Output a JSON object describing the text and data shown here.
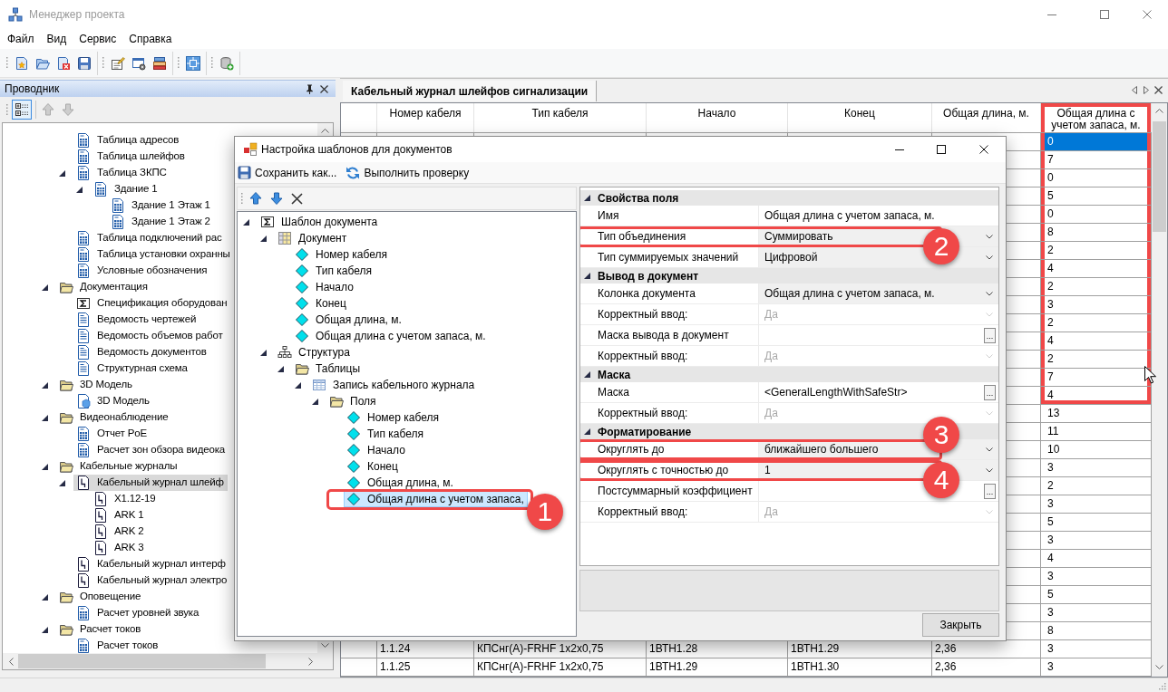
{
  "window": {
    "title": "Менеджер проекта"
  },
  "menu": [
    {
      "label": "Файл"
    },
    {
      "label": "Вид"
    },
    {
      "label": "Сервис"
    },
    {
      "label": "Справка"
    }
  ],
  "explorer": {
    "title": "Проводник",
    "tree": [
      {
        "children": [
          {
            "label": "Таблица адресов",
            "kind": "table",
            "selected": false
          },
          {
            "label": "Таблица шлейфов",
            "kind": "table",
            "selected": false
          },
          {
            "label": "Таблица ЗКПС",
            "kind": "table",
            "selected": false,
            "expanded": true,
            "children": [
              {
                "label": "Здание 1",
                "kind": "table",
                "selected": false,
                "expanded": true,
                "children": [
                  {
                    "label": "Здание 1 Этаж 1",
                    "kind": "table",
                    "selected": false
                  },
                  {
                    "label": "Здание 1 Этаж 2",
                    "kind": "table",
                    "selected": false
                  }
                ]
              }
            ]
          },
          {
            "label": "Таблица подключений рас",
            "kind": "table",
            "selected": false
          },
          {
            "label": "Таблица установки охранны",
            "kind": "table",
            "selected": false
          },
          {
            "label": "Условные обозначения",
            "kind": "table",
            "selected": false
          }
        ]
      },
      {
        "label": "Документация",
        "kind": "folder",
        "selected": false,
        "expanded": true,
        "children": [
          {
            "label": "Спецификация оборудован",
            "kind": "sigma",
            "selected": false
          },
          {
            "label": "Ведомость чертежей",
            "kind": "document",
            "selected": false
          },
          {
            "label": "Ведомость объемов работ",
            "kind": "document",
            "selected": false
          },
          {
            "label": "Ведомость документов",
            "kind": "document",
            "selected": false
          },
          {
            "label": "Структурная схема",
            "kind": "document",
            "selected": false
          }
        ]
      },
      {
        "label": "3D Модель",
        "kind": "folder",
        "selected": false,
        "expanded": true,
        "children": [
          {
            "label": "3D Модель",
            "kind": "model",
            "selected": false
          }
        ]
      },
      {
        "label": "Видеонаблюдение",
        "kind": "folder",
        "selected": false,
        "expanded": true,
        "children": [
          {
            "label": "Отчет PoE",
            "kind": "table",
            "selected": false
          },
          {
            "label": "Расчет зон обзора видеока",
            "kind": "table",
            "selected": false
          }
        ]
      },
      {
        "label": "Кабельные журналы",
        "kind": "folder",
        "selected": false,
        "expanded": true,
        "children": [
          {
            "label": "Кабельный журнал шлейф",
            "kind": "journal",
            "selected": true,
            "expanded": true,
            "children": [
              {
                "label": "X1.12-19",
                "kind": "journal",
                "selected": false
              },
              {
                "label": "ARK 1",
                "kind": "journal",
                "selected": false
              },
              {
                "label": "ARK 2",
                "kind": "journal",
                "selected": false
              },
              {
                "label": "ARK 3",
                "kind": "journal",
                "selected": false
              }
            ]
          },
          {
            "label": "Кабельный журнал интерф",
            "kind": "journal",
            "selected": false
          },
          {
            "label": "Кабельный журнал электро",
            "kind": "journal",
            "selected": false
          }
        ]
      },
      {
        "label": "Оповещение",
        "kind": "folder",
        "selected": false,
        "expanded": true,
        "children": [
          {
            "label": "Расчет уровней звука",
            "kind": "table",
            "selected": false
          }
        ]
      },
      {
        "label": "Расчет токов",
        "kind": "folder",
        "selected": false,
        "expanded": true,
        "children": [
          {
            "label": "Расчет токов",
            "kind": "table",
            "selected": false
          }
        ]
      }
    ]
  },
  "tabs": [
    {
      "label": "Кабельный журнал шлейфов сигнализации",
      "selected": true
    }
  ],
  "table": {
    "columns": [
      {
        "label": "Номер кабеля",
        "highlighted": false
      },
      {
        "label": "Тип кабеля",
        "highlighted": false
      },
      {
        "label": "Начало",
        "highlighted": false
      },
      {
        "label": "Конец",
        "highlighted": false
      },
      {
        "label": "Общая длина, м.",
        "highlighted": false
      },
      {
        "label": "Общая длина с учетом запаса, м.",
        "highlighted": true
      }
    ],
    "rows": [
      {
        "total_length_with_reserve": "0",
        "selected": true,
        "highlighted": true
      },
      {
        "total_length_with_reserve": "7",
        "selected": false,
        "highlighted": true
      },
      {
        "total_length_with_reserve": "0",
        "selected": false,
        "highlighted": true
      },
      {
        "total_length_with_reserve": "5",
        "selected": false,
        "highlighted": true
      },
      {
        "total_length_with_reserve": "0",
        "selected": false,
        "highlighted": true
      },
      {
        "total_length_with_reserve": "8",
        "selected": false,
        "highlighted": true
      },
      {
        "total_length_with_reserve": "2",
        "selected": false,
        "highlighted": true
      },
      {
        "total_length_with_reserve": "4",
        "selected": false,
        "highlighted": true
      },
      {
        "total_length_with_reserve": "2",
        "selected": false,
        "highlighted": true
      },
      {
        "total_length_with_reserve": "3",
        "selected": false,
        "highlighted": true
      },
      {
        "total_length_with_reserve": "2",
        "selected": false,
        "highlighted": true
      },
      {
        "total_length_with_reserve": "4",
        "selected": false,
        "highlighted": true
      },
      {
        "total_length_with_reserve": "2",
        "selected": false,
        "highlighted": true
      },
      {
        "total_length_with_reserve": "7",
        "selected": false,
        "highlighted": true
      },
      {
        "total_length_with_reserve": "4",
        "selected": false,
        "highlighted": true
      },
      {
        "total_length_with_reserve": "13",
        "selected": false,
        "highlighted": false
      },
      {
        "total_length_with_reserve": "11",
        "selected": false,
        "highlighted": false
      },
      {
        "total_length_with_reserve": "10",
        "selected": false,
        "highlighted": false
      },
      {
        "total_length_with_reserve": "3",
        "selected": false,
        "highlighted": false
      },
      {
        "total_length_with_reserve": "2",
        "selected": false,
        "highlighted": false
      },
      {
        "total_length_with_reserve": "3",
        "selected": false,
        "highlighted": false
      },
      {
        "total_length_with_reserve": "5",
        "selected": false,
        "highlighted": false
      },
      {
        "total_length_with_reserve": "3",
        "selected": false,
        "highlighted": false
      },
      {
        "total_length_with_reserve": "4",
        "selected": false,
        "highlighted": false
      },
      {
        "total_length_with_reserve": "3",
        "selected": false,
        "highlighted": false
      },
      {
        "total_length_with_reserve": "5",
        "selected": false,
        "highlighted": false
      },
      {
        "total_length_with_reserve": "3",
        "selected": false,
        "highlighted": false
      },
      {
        "total_length_with_reserve": "8",
        "selected": false,
        "highlighted": false
      },
      {
        "cable_number": "1.1.24",
        "cable_type": "КПСнг(А)-FRHF 1x2x0,75",
        "start": "1ВТН1.28",
        "end": "1ВТН1.29",
        "total_length": "2,36",
        "total_length_with_reserve": "3",
        "selected": false,
        "highlighted": false
      },
      {
        "cable_number": "1.1.25",
        "cable_type": "КПСнг(А)-FRHF 1x2x0,75",
        "start": "1ВТН1.29",
        "end": "1ВТН1.30",
        "total_length": "2,36",
        "total_length_with_reserve": "3",
        "selected": false,
        "highlighted": false
      }
    ]
  },
  "dialog": {
    "title": "Настройка шаблонов для документов",
    "toolbar": [
      {
        "label": "Сохранить как...",
        "kind": "save"
      },
      {
        "label": "Выполнить проверку",
        "kind": "check"
      }
    ],
    "tree": [
      {
        "label": "Шаблон документа",
        "kind": "sigma",
        "selected": false,
        "expanded": true,
        "children": [
          {
            "label": "Документ",
            "kind": "grid",
            "selected": false,
            "expanded": true,
            "children": [
              {
                "label": "Номер кабеля",
                "kind": "field",
                "selected": false
              },
              {
                "label": "Тип кабеля",
                "kind": "field",
                "selected": false
              },
              {
                "label": "Начало",
                "kind": "field",
                "selected": false
              },
              {
                "label": "Конец",
                "kind": "field",
                "selected": false
              },
              {
                "label": "Общая длина, м.",
                "kind": "field",
                "selected": false
              },
              {
                "label": "Общая длина с учетом запаса, м.",
                "kind": "field",
                "selected": false
              }
            ]
          },
          {
            "label": "Структура",
            "kind": "structure",
            "selected": false,
            "expanded": true,
            "children": [
              {
                "label": "Таблицы",
                "kind": "folder",
                "selected": false,
                "expanded": true,
                "children": [
                  {
                    "label": "Запись кабельного журнала",
                    "kind": "record_table",
                    "selected": false,
                    "expanded": true,
                    "children": [
                      {
                        "label": "Поля",
                        "kind": "folder",
                        "selected": false,
                        "expanded": true,
                        "children": [
                          {
                            "label": "Номер кабеля",
                            "kind": "field",
                            "selected": false
                          },
                          {
                            "label": "Тип кабеля",
                            "kind": "field",
                            "selected": false
                          },
                          {
                            "label": "Начало",
                            "kind": "field",
                            "selected": false
                          },
                          {
                            "label": "Конец",
                            "kind": "field",
                            "selected": false
                          },
                          {
                            "label": "Общая длина, м.",
                            "kind": "field",
                            "selected": false
                          },
                          {
                            "label": "Общая длина с учетом запаса,",
                            "kind": "field",
                            "selected": true,
                            "callout": "1"
                          }
                        ]
                      }
                    ]
                  }
                ]
              }
            ]
          }
        ]
      }
    ],
    "properties": [
      {
        "section": "Свойства поля",
        "expanded": true,
        "rows": [
          {
            "label": "Имя",
            "value": "Общая длина с учетом запаса, м.",
            "kind": "text",
            "disabled": false
          },
          {
            "label": "Тип объединения",
            "value": "Суммировать",
            "kind": "dropdown",
            "disabled": false,
            "callout": "2"
          },
          {
            "label": "Тип суммируемых значений",
            "value": "Цифровой",
            "kind": "dropdown",
            "disabled": false
          }
        ]
      },
      {
        "section": "Вывод в документ",
        "expanded": true,
        "rows": [
          {
            "label": "Колонка документа",
            "value": "Общая длина с учетом запаса, м.",
            "kind": "dropdown",
            "disabled": false
          },
          {
            "label": "Корректный ввод:",
            "value": "Да",
            "kind": "dropdown",
            "disabled": true
          },
          {
            "label": "Маска вывода в документ",
            "kind": "ellipsis",
            "button": "...",
            "disabled": false
          },
          {
            "label": "Корректный ввод:",
            "value": "Да",
            "kind": "dropdown",
            "disabled": true
          }
        ]
      },
      {
        "section": "Маска",
        "expanded": true,
        "rows": [
          {
            "label": "Маска",
            "value": "<GeneralLengthWithSafeStr>",
            "kind": "ellipsis",
            "button": "...",
            "disabled": false
          },
          {
            "label": "Корректный ввод:",
            "value": "Да",
            "kind": "dropdown",
            "disabled": true
          }
        ]
      },
      {
        "section": "Форматирование",
        "expanded": true,
        "rows": [
          {
            "label": "Округлять до",
            "value": "ближайшего большего",
            "kind": "dropdown",
            "disabled": false,
            "callout": "3"
          },
          {
            "label": "Округлять с точностью до",
            "value": "1",
            "kind": "dropdown",
            "disabled": false,
            "callout": "4"
          },
          {
            "label": "Постсуммарный коэффициент",
            "kind": "ellipsis",
            "button": "...",
            "disabled": false
          },
          {
            "label": "Корректный ввод:",
            "value": "Да",
            "kind": "dropdown",
            "disabled": true
          }
        ]
      }
    ],
    "close_button": "Закрыть"
  }
}
